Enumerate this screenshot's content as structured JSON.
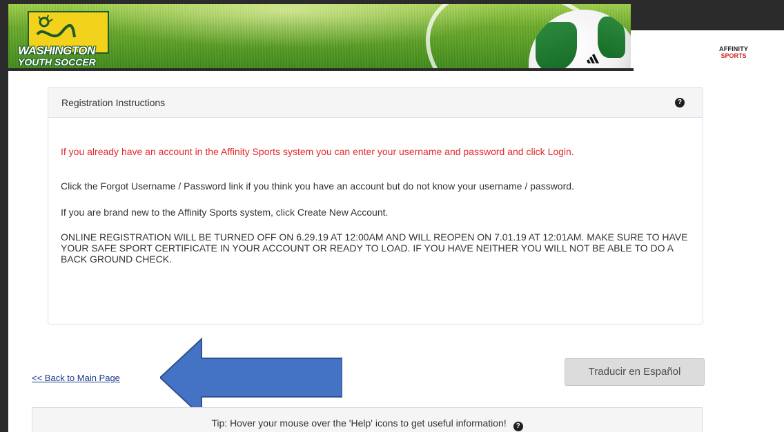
{
  "header": {
    "logo_line1": "WASHINGTON",
    "logo_line2": "YOUTH SOCCER",
    "ball_brand": "adidas",
    "partner_line1": "AFFINITY",
    "partner_line2": "SPORTS"
  },
  "panel": {
    "title": "Registration Instructions",
    "help_icon": "question-circle-icon",
    "login_notice": "If you already have an account in the Affinity Sports system you can enter your username and password and click Login.",
    "forgot_notice": "Click the Forgot Username / Password link if you think you have an account but do not know your username / password.",
    "new_account_notice": "If you are brand new to the Affinity Sports system, click Create New Account.",
    "online_notice": "ONLINE REGISTRATION WILL BE TURNED OFF ON 6.29.19 AT 12:00AM AND WILL REOPEN ON 7.01.19 AT 12:01AM. MAKE SURE TO HAVE YOUR SAFE SPORT CERTIFICATE IN YOUR ACCOUNT OR READY TO LOAD.  IF YOU HAVE NEITHER YOU WILL NOT BE ABLE TO DO A BACK GROUND CHECK."
  },
  "nav": {
    "back_link": "<< Back to Main Page"
  },
  "actions": {
    "translate_label": "Traducir en Español"
  },
  "tip": {
    "text": "Tip: Hover your mouse over the 'Help' icons to get useful information!",
    "help_icon": "question-circle-icon"
  },
  "colors": {
    "alert_red": "#e3292c",
    "link_blue": "#1a3a8a",
    "arrow_blue": "#4472c4",
    "panel_border": "#d9e4ee"
  }
}
